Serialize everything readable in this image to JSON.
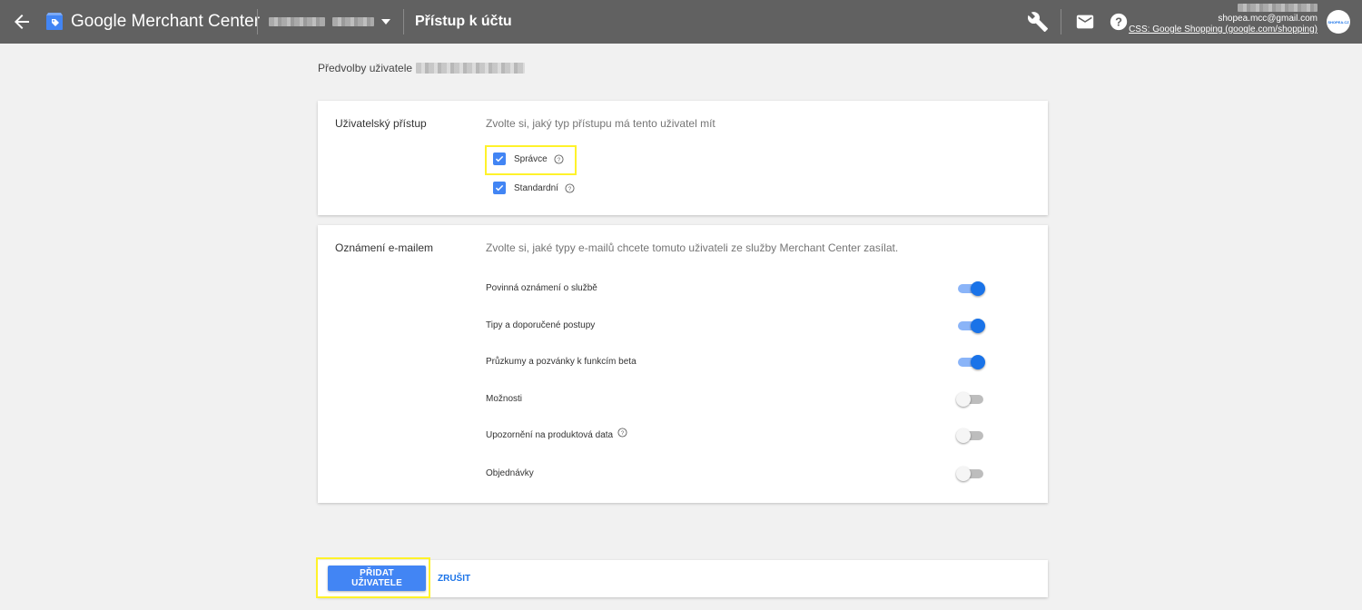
{
  "header": {
    "brand": "Google Merchant Center",
    "page_title": "Přístup k účtu",
    "user_email": "shopea.mcc@gmail.com",
    "css_link": "CSS: Google Shopping (google.com/shopping)",
    "avatar_text": "SHOPEA.CZ"
  },
  "prefs": {
    "label": "Předvolby uživatele"
  },
  "access": {
    "label": "Uživatelský přístup",
    "description": "Zvolte si, jaký typ přístupu má tento uživatel mít",
    "options": [
      {
        "label": "Správce",
        "checked": true
      },
      {
        "label": "Standardní",
        "checked": true
      }
    ]
  },
  "email": {
    "label": "Oznámení e-mailem",
    "description": "Zvolte si, jaké typy e-mailů chcete tomuto uživateli ze služby Merchant Center zasílat.",
    "items": [
      {
        "label": "Povinná oznámení o službě",
        "on": true
      },
      {
        "label": "Tipy a doporučené postupy",
        "on": true
      },
      {
        "label": "Průzkumy a pozvánky k funkcím beta",
        "on": true
      },
      {
        "label": "Možnosti",
        "on": false
      },
      {
        "label": "Upozornění na produktová data",
        "on": false
      },
      {
        "label": "Objednávky",
        "on": false
      }
    ]
  },
  "actions": {
    "add_label": "PŘIDAT UŽIVATELE",
    "cancel_label": "ZRUŠIT"
  },
  "colors": {
    "topbar": "#616161",
    "primary": "#4285f4",
    "toggle_on": "#1a73e8",
    "highlight": "#fff22a"
  }
}
